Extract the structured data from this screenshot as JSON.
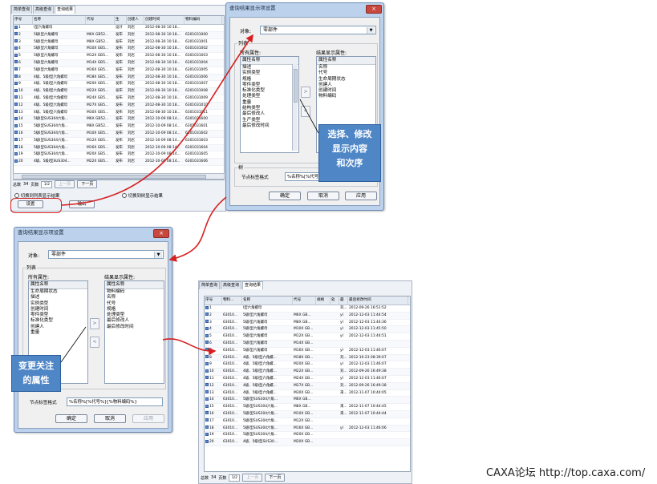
{
  "panel1": {
    "tabs": [
      "简单查询",
      "高级查询",
      "查询结果"
    ],
    "columns": [
      "序号",
      "名称",
      "代号",
      "生",
      "创建人",
      "创建时间",
      "物料编码"
    ],
    "rows": [
      [
        "1",
        "I型六角螺母",
        "",
        "设计",
        "刘岩",
        "2012-08-30 10:18...",
        ""
      ],
      [
        "2",
        "5级I型六角螺母",
        "M6X GB52...",
        "发布",
        "刘岩",
        "2012-08-30 10:18...",
        "6301031000"
      ],
      [
        "3",
        "5级I型六角螺母",
        "M8X GB52...",
        "发布",
        "刘岩",
        "2012-08-30 10:18...",
        "6301031001"
      ],
      [
        "4",
        "5级I型六角螺母",
        "M10X GB5...",
        "发布",
        "刘岩",
        "2012-08-30 10:18...",
        "6301031002"
      ],
      [
        "5",
        "5级I型六角螺母",
        "M12X GB5...",
        "发布",
        "刘岩",
        "2012-08-30 10:18...",
        "6301031003"
      ],
      [
        "6",
        "5级I型六角螺母",
        "M14X GB5...",
        "发布",
        "刘岩",
        "2012-08-30 10:18...",
        "6301031004"
      ],
      [
        "7",
        "5级I型六角螺母",
        "M16X GB5...",
        "发布",
        "刘岩",
        "2012-08-30 10:18...",
        "6301031005"
      ],
      [
        "8",
        "4级、5级I型六角螺母",
        "M18X GB5...",
        "发布",
        "刘岩",
        "2012-08-30 10:18...",
        "6301031006"
      ],
      [
        "9",
        "4级、5级I型六角螺母",
        "M20X GB5...",
        "发布",
        "刘岩",
        "2012-08-30 10:18...",
        "6301031007"
      ],
      [
        "10",
        "4级、5级I型六角螺母",
        "M22X GB5...",
        "发布",
        "刘岩",
        "2012-08-30 10:18...",
        "6301031008"
      ],
      [
        "11",
        "4级、5级I型六角螺母",
        "M24X GB5...",
        "发布",
        "刘岩",
        "2012-08-30 10:18...",
        "6301031009"
      ],
      [
        "12",
        "4级、5级I型六角螺母",
        "M27X GB5...",
        "发布",
        "刘岩",
        "2012-08-30 10:18...",
        "6301031010"
      ],
      [
        "13",
        "4级、5级I型六角螺母",
        "M30X GB5...",
        "发布",
        "刘岩",
        "2012-08-30 10:18...",
        "6301031011"
      ],
      [
        "14",
        "5级I型SUS304六角...",
        "M6X GB52...",
        "发布",
        "刘岩",
        "2012-10-09 08:14...",
        "6301031600"
      ],
      [
        "15",
        "5级I型SUS304六角...",
        "M8X GB52...",
        "发布",
        "刘岩",
        "2012-10-09 08:14...",
        "6301031601"
      ],
      [
        "16",
        "5级I型SUS304六角...",
        "M10X GB5...",
        "发布",
        "刘岩",
        "2012-10-09 08:14...",
        "6301031602"
      ],
      [
        "17",
        "5级I型SUS304六角...",
        "M12X GB5...",
        "发布",
        "刘岩",
        "2012-10-09 08:14...",
        "6301031603"
      ],
      [
        "18",
        "5级I型SUS304六角...",
        "M16X GB5...",
        "发布",
        "刘岩",
        "2012-10-09 08:14...",
        "6301031604"
      ],
      [
        "19",
        "5级I型SUS304六角...",
        "M20X GB5...",
        "发布",
        "刘岩",
        "2012-10-09 08:14...",
        "6301031605"
      ],
      [
        "20",
        "4级、5级I型SUS304...",
        "M22X GB5...",
        "发布",
        "刘岩",
        "2012-10-09 08:14...",
        "6301031606"
      ]
    ],
    "pager": {
      "total_label": "总数",
      "total": "34",
      "pages_label": "页数",
      "pages": "1/2",
      "prev": "上一页",
      "next": "下一页"
    },
    "switch_to_list": "切换到列表显示结果",
    "switch_to_tree": "切换到树显示结果",
    "settings": "设置",
    "output": "输出"
  },
  "dialog1": {
    "title": "查询结果显示项设置",
    "close": "×",
    "object_label": "对象:",
    "object_value": "零部件",
    "list_group": "列表",
    "all_attrs_label": "所有属性:",
    "all_attrs_header": "属性名称",
    "all_attrs": [
      "描述",
      "实例类型",
      "规格",
      "零件类型",
      "标准化类型",
      "处理类型",
      "重量",
      "结构类型",
      "最后修改人",
      "生产类型",
      "最后修改时间"
    ],
    "result_attrs_label": "结果显示属性:",
    "result_attrs_header": "属性名称",
    "result_attrs": [
      "名称",
      "代号",
      "生命周期状态",
      "创建人",
      "创建时间",
      "物料编码"
    ],
    "add": ">",
    "remove": "<",
    "tree_group": "树",
    "node_format_label": "节点标签格式",
    "node_format_value": "%名称%[%代号%]",
    "ok": "确定",
    "cancel": "取消",
    "apply": "应用"
  },
  "callout1": [
    "选择、修改",
    "显示内容",
    "和次序"
  ],
  "dialog2": {
    "title": "查询结果显示项设置",
    "close": "×",
    "object_label": "对象:",
    "object_value": "零部件",
    "list_group": "列表",
    "all_attrs_label": "所有属性:",
    "all_attrs_header": "属性名称",
    "all_attrs": [
      "生命周期状态",
      "描述",
      "实例类型",
      "创建时间",
      "零件类型",
      "标准化类型",
      "创建人",
      "重量"
    ],
    "result_attrs_label": "结果显示属性:",
    "result_attrs_header": "属性名称",
    "result_attrs": [
      "物料编码",
      "名称",
      "代号",
      "规格",
      "处理类型",
      "最后修改人",
      "最后修改时间"
    ],
    "add": ">",
    "remove": "<",
    "node_format_label": "节点标签格式",
    "node_format_value": "%名称%[%代号%]{%物料编码%}",
    "ok": "确定",
    "cancel": "取消",
    "apply": "应用"
  },
  "callout2": [
    "变更关注",
    "的属性"
  ],
  "panel2": {
    "tabs": [
      "简单查询",
      "高级查询",
      "查询结果"
    ],
    "columns": [
      "序号",
      "物料...",
      "名称",
      "代号",
      "规格",
      "处",
      "最",
      "最后修改时间"
    ],
    "rows": [
      [
        "1",
        "",
        "I型六角螺母",
        "",
        "",
        "",
        "刘...",
        "2012-09-26 16:51:52"
      ],
      [
        "2",
        "63010...",
        "5级I型六角螺母",
        "M6X GB...",
        "",
        "",
        "yl",
        "2012-12-03 11:44:54"
      ],
      [
        "3",
        "63010...",
        "5级I型六角螺母",
        "M8X GB...",
        "",
        "",
        "yl",
        "2012-12-03 11:44:36"
      ],
      [
        "4",
        "63010...",
        "5级I型六角螺母",
        "M10X GB...",
        "",
        "",
        "yl",
        "2012-12-03 11:45:50"
      ],
      [
        "5",
        "63010...",
        "5级I型六角螺母",
        "M12X GB...",
        "",
        "",
        "yl",
        "2012-12-03 11:44:51"
      ],
      [
        "6",
        "63010...",
        "5级I型六角螺母",
        "M14X GB...",
        "",
        "",
        "",
        ""
      ],
      [
        "7",
        "63010...",
        "5级I型六角螺母",
        "M16X GB...",
        "",
        "",
        "yl",
        "2012-12-03 11:46:07"
      ],
      [
        "8",
        "63010...",
        "4级、5级I型六角螺...",
        "M18X GB...",
        "",
        "",
        "刘...",
        "2012-10-23 08:39:07"
      ],
      [
        "9",
        "63010...",
        "4级、5级I型六角螺...",
        "M20X GB...",
        "",
        "",
        "yl",
        "2012-12-03 11:46:07"
      ],
      [
        "10",
        "63010...",
        "4级、5级I型六角螺...",
        "M22X GB...",
        "",
        "",
        "刘...",
        "2012-09-26 16:49:38"
      ],
      [
        "11",
        "63010...",
        "4级、5级I型六角螺...",
        "M24X GB...",
        "",
        "",
        "yl",
        "2012-12-03 11:46:07"
      ],
      [
        "12",
        "63010...",
        "4级、5级I型六角螺...",
        "M27X GB...",
        "",
        "",
        "刘...",
        "2012-09-26 16:49:38"
      ],
      [
        "13",
        "63010...",
        "4级、5级I型六角螺...",
        "M30X GB...",
        "",
        "",
        "来...",
        "2012-11-07 10:44:05"
      ],
      [
        "14",
        "63010...",
        "5级I型SUS304六角...",
        "M6X GB...",
        "",
        "",
        "",
        ""
      ],
      [
        "15",
        "63010...",
        "5级I型SUS304六角...",
        "M8X GB...",
        "",
        "",
        "来...",
        "2012-11-07 10:44:45"
      ],
      [
        "16",
        "63010...",
        "5级I型SUS304六角...",
        "M10X GB...",
        "",
        "",
        "来...",
        "2012-11-07 10:44:44"
      ],
      [
        "17",
        "63010...",
        "5级I型SUS304六角...",
        "M12X GB...",
        "",
        "",
        "",
        ""
      ],
      [
        "18",
        "63010...",
        "5级I型SUS304六角...",
        "M16X GB...",
        "",
        "",
        "yl",
        "2012-12-03 11:46:06"
      ],
      [
        "19",
        "63010...",
        "5级I型SUS304六角...",
        "M20X GB...",
        "",
        "",
        "",
        ""
      ],
      [
        "20",
        "63010...",
        "4级、5级I型SUS30...",
        "M20X GB...",
        "",
        "",
        "",
        ""
      ]
    ],
    "pager": {
      "total_label": "总数",
      "total": "34",
      "pages_label": "页数",
      "pages": "1/2",
      "prev": "上一页",
      "next": "下一页"
    }
  },
  "watermark": "CAXA论坛 http://top.caxa.com/",
  "colors": {
    "callout": "#4f86c6",
    "arrow": "#d62020",
    "dialog_frame": "#bcd2ec"
  }
}
